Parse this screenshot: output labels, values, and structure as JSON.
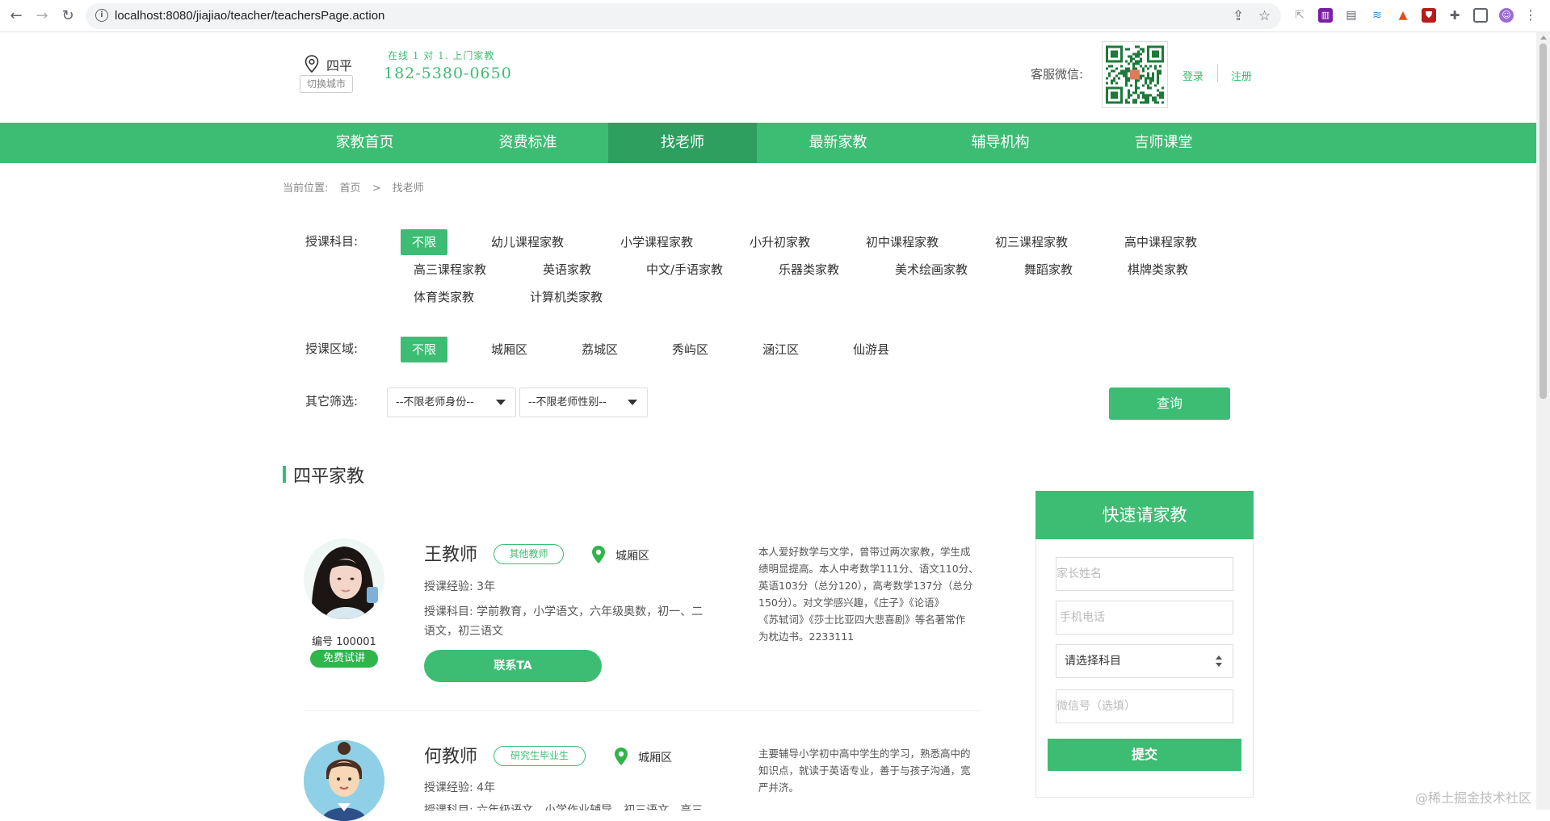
{
  "browser": {
    "url": "localhost:8080/jiajiao/teacher/teachersPage.action"
  },
  "header": {
    "city": "四平",
    "switch_city": "切换城市",
    "slogan": "在线 1 对 1. 上门家教",
    "phone": "182-5380-0650",
    "wechat_label": "客服微信:",
    "login": "登录",
    "register": "注册"
  },
  "nav": {
    "items": [
      {
        "label": "家教首页"
      },
      {
        "label": "资费标准"
      },
      {
        "label": "找老师"
      },
      {
        "label": "最新家教"
      },
      {
        "label": "辅导机构"
      },
      {
        "label": "吉师课堂"
      }
    ],
    "active_index": 2
  },
  "breadcrumb": {
    "prefix": "当前位置:",
    "home": "首页",
    "sep": ">",
    "current": "找老师"
  },
  "filters": {
    "subject_label": "授课科目:",
    "subjects": [
      "不限",
      "幼儿课程家教",
      "小学课程家教",
      "小升初家教",
      "初中课程家教",
      "初三课程家教",
      "高中课程家教",
      "高三课程家教",
      "英语家教",
      "中文/手语家教",
      "乐器类家教",
      "美术绘画家教",
      "舞蹈家教",
      "棋牌类家教",
      "体育类家教",
      "计算机类家教"
    ],
    "area_label": "授课区域:",
    "areas": [
      "不限",
      "城厢区",
      "荔城区",
      "秀屿区",
      "涵江区",
      "仙游县"
    ],
    "other_label": "其它筛选:",
    "identity_select": "--不限老师身份--",
    "gender_select": "--不限老师性别--",
    "query_button": "查询"
  },
  "section_title": "四平家教",
  "teachers": [
    {
      "name": "王教师",
      "tag": "其他教师",
      "area": "城厢区",
      "id_label": "编号 100001",
      "trial": "免费试讲",
      "experience": "授课经验:  3年",
      "subjects_line1": "授课科目:  学前教育，小学语文，六年级奥数，初一、二",
      "subjects_line2": "语文，初三语文",
      "contact": "联系TA",
      "intro": [
        "本人爱好数学与文学，曾带过两次家教，学生成",
        "绩明显提高。本人中考数学111分、语文110分、",
        "英语103分（总分120），高考数学137分（总分",
        "150分）。对文学感兴趣，《庄子》《论语》",
        "《苏轼词》《莎士比亚四大悲喜剧》等名著常作",
        "为枕边书。2233111"
      ]
    },
    {
      "name": "何教师",
      "tag": "研究生毕业生",
      "area": "城厢区",
      "experience": "授课经验:  4年",
      "subjects_line1": "授课科目:  六年级语文，小学作业辅导，初三语文，高三",
      "intro": [
        "主要辅导小学初中高中学生的学习，熟悉高中的",
        "知识点，就读于英语专业，善于与孩子沟通，宽",
        "严并济。"
      ]
    }
  ],
  "quick_form": {
    "title": "快速请家教",
    "parent_name_placeholder": "家长姓名",
    "phone_placeholder": "手机电话",
    "subject_select": "请选择科目",
    "wechat_placeholder": "微信号（选填）",
    "submit": "提交"
  },
  "watermark": "@稀土掘金技术社区",
  "colors": {
    "brand_green": "#3dbd73",
    "nav_active": "#2f9f5f",
    "trial_badge": "#2fb54a"
  }
}
